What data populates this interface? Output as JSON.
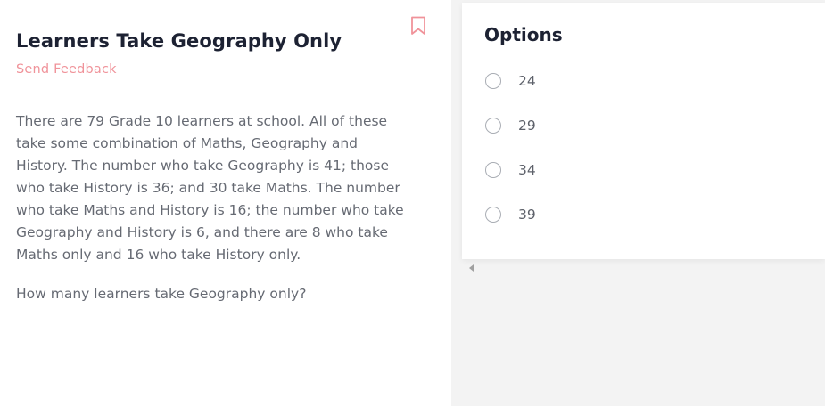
{
  "question": {
    "title": "Learners Take Geography Only",
    "feedback_label": "Send Feedback",
    "body": "There are 79 Grade 10 learners at school. All of these take some combination of Maths, Geography and History. The number who take Geography is 41; those who take History is 36; and 30 take Maths. The number who take Maths and History is 16; the number who take Geography and History is 6, and there are 8 who take Maths only and 16 who take History only.",
    "ask": "How many learners take Geography only?",
    "bookmark_icon": "bookmark-icon"
  },
  "options": {
    "title": "Options",
    "items": [
      {
        "label": "24",
        "selected": false
      },
      {
        "label": "29",
        "selected": false
      },
      {
        "label": "34",
        "selected": false
      },
      {
        "label": "39",
        "selected": false
      }
    ]
  },
  "colors": {
    "accent": "#f0939a",
    "heading": "#1d2233",
    "body_text": "#666a73",
    "panel_bg": "#f3f3f3"
  }
}
